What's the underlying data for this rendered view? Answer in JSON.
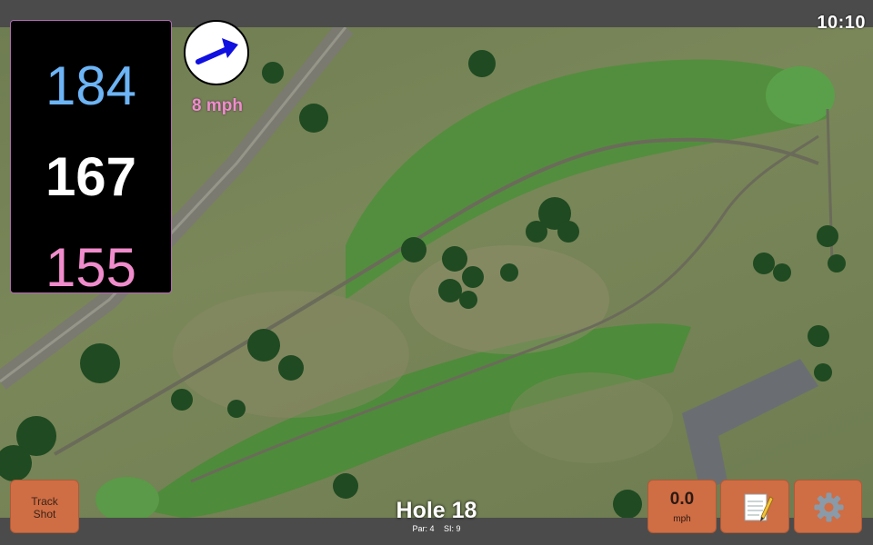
{
  "clock": "10:10",
  "distances": {
    "back": "184",
    "middle": "167",
    "front": "155"
  },
  "wind": {
    "speed_label": "8 mph",
    "icon": "wind-arrow-icon"
  },
  "hole": {
    "title": "Hole 18",
    "par_label": "Par: 4",
    "si_label": "SI: 9"
  },
  "buttons": {
    "track_shot": "Track Shot",
    "speed_value": "0.0",
    "speed_unit": "mph",
    "notes_icon": "notepad-icon",
    "settings_icon": "gear-icon"
  },
  "colors": {
    "accent_button": "#cf6d44",
    "back_distance": "#6cb4f5",
    "front_distance": "#f08ccc",
    "wind_arrow": "#1010e0"
  }
}
